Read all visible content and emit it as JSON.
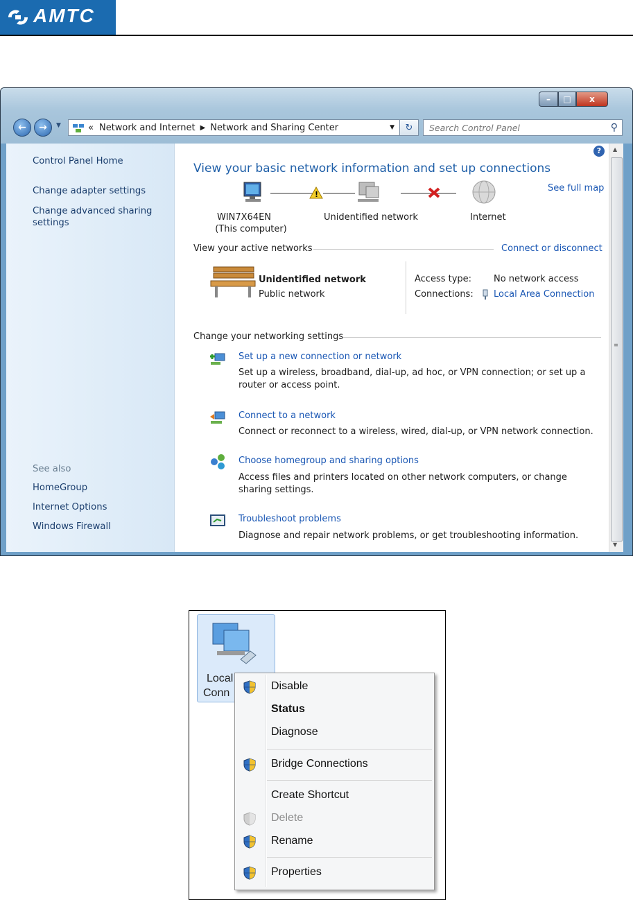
{
  "doc_header": {
    "logo_text": "AMTC"
  },
  "window": {
    "address": {
      "chevron": "«",
      "segment1": "Network and Internet",
      "segment2": "Network and Sharing Center"
    },
    "search_placeholder": "Search Control Panel",
    "caption": {
      "minimize": "–",
      "maximize": "□",
      "close": "x"
    },
    "sidebar": {
      "home": "Control Panel Home",
      "adapter": "Change adapter settings",
      "advanced": "Change advanced sharing settings",
      "see_also": "See also",
      "homegroup": "HomeGroup",
      "internet_options": "Internet Options",
      "firewall": "Windows Firewall"
    },
    "main": {
      "title": "View your basic network information and set up connections",
      "see_full_map": "See full map",
      "map": {
        "computer_name": "WIN7X64EN",
        "computer_sub": "(This computer)",
        "network": "Unidentified network",
        "internet": "Internet"
      },
      "active_header": "View your active networks",
      "connect_disconnect": "Connect or disconnect",
      "active": {
        "name": "Unidentified network",
        "type": "Public network",
        "access_label": "Access type:",
        "access_value": "No network access",
        "connections_label": "Connections:",
        "connections_value": "Local Area Connection"
      },
      "settings_header": "Change your networking settings",
      "tasks": [
        {
          "title": "Set up a new connection or network",
          "desc": "Set up a wireless, broadband, dial-up, ad hoc, or VPN connection; or set up a router or access point."
        },
        {
          "title": "Connect to a network",
          "desc": "Connect or reconnect to a wireless, wired, dial-up, or VPN network connection."
        },
        {
          "title": "Choose homegroup and sharing options",
          "desc": "Access files and printers located on other network computers, or change sharing settings."
        },
        {
          "title": "Troubleshoot problems",
          "desc": "Diagnose and repair network problems, or get troubleshooting information."
        }
      ]
    }
  },
  "context": {
    "icon_label_line1": "Local A",
    "icon_label_line2": "Conn",
    "menu": {
      "disable": "Disable",
      "status": "Status",
      "diagnose": "Diagnose",
      "bridge": "Bridge Connections",
      "shortcut": "Create Shortcut",
      "delete": "Delete",
      "rename": "Rename",
      "properties": "Properties"
    }
  },
  "colors": {
    "link": "#1a57b4",
    "title": "#1f5fa8",
    "logo_bg": "#1b6bb0",
    "disabled": "#8d8d8d"
  }
}
